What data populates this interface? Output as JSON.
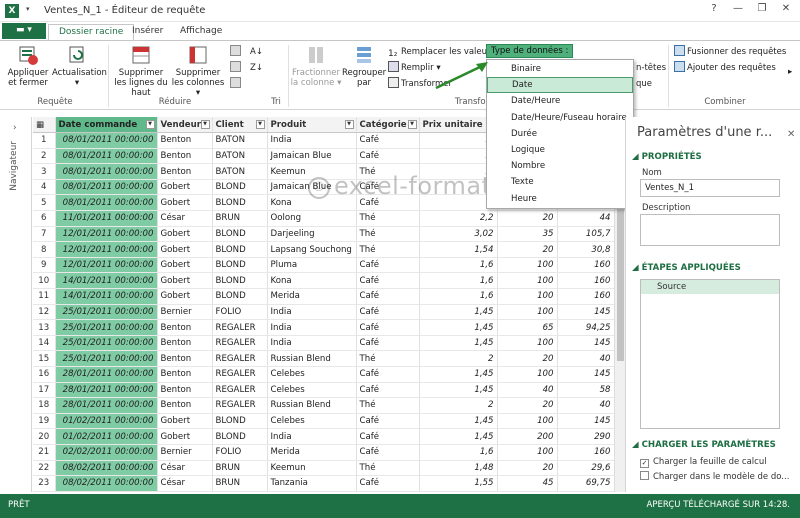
{
  "window": {
    "title": "Ventes_N_1 - Éditeur de requête"
  },
  "ribbon_tabs": [
    "Dossier racine",
    "Insérer",
    "Affichage"
  ],
  "ribbon": {
    "apply_close": "Appliquer et fermer",
    "refresh": "Actualisation",
    "remove_top_rows": "Supprimer les lignes du haut",
    "remove_columns": "Supprimer les colonnes",
    "split_column": "Fractionner la colonne",
    "group_by": "Regrouper par",
    "replace_values": "Remplacer les valeurs",
    "fill": "Remplir",
    "transform": "Transformer",
    "data_type_label": "Type de données :",
    "merge_queries": "Fusionner des requêtes",
    "append_queries": "Ajouter des requêtes",
    "partial_right": "n-têtes",
    "partial_right2": "que",
    "groups": {
      "query": "Requête",
      "reduce": "Réduire",
      "sort": "Tri",
      "transform": "Transfor",
      "combine": "Combiner"
    }
  },
  "data_type_menu": {
    "items": [
      "Binaire",
      "Date",
      "Date/Heure",
      "Date/Heure/Fuseau horaire",
      "Durée",
      "Logique",
      "Nombre",
      "Texte",
      "Heure"
    ],
    "selected": "Date"
  },
  "navigator": {
    "label": "Navigateur"
  },
  "grid": {
    "columns": [
      "Date commande",
      "Vendeur",
      "Client",
      "Produit",
      "Catégorie",
      "Prix unitaire",
      "",
      ""
    ],
    "rows": [
      [
        "1",
        "08/01/2011 00:00:00",
        "Benton",
        "BATON",
        "India",
        "Café",
        "1,",
        "",
        ""
      ],
      [
        "2",
        "08/01/2011 00:00:00",
        "Benton",
        "BATON",
        "Jamaican Blue",
        "Café",
        "1,",
        "",
        ""
      ],
      [
        "3",
        "08/01/2011 00:00:00",
        "Benton",
        "BATON",
        "Keemun",
        "Thé",
        "1,",
        "",
        ""
      ],
      [
        "4",
        "08/01/2011 00:00:00",
        "Gobert",
        "BLOND",
        "Jamaican Blue",
        "Café",
        "",
        "",
        ""
      ],
      [
        "5",
        "08/01/2011 00:00:00",
        "Gobert",
        "BLOND",
        "Kona",
        "Café",
        "",
        "",
        ""
      ],
      [
        "6",
        "11/01/2011 00:00:00",
        "César",
        "BRUN",
        "Oolong",
        "Thé",
        "2,2",
        "20",
        "44"
      ],
      [
        "7",
        "12/01/2011 00:00:00",
        "Gobert",
        "BLOND",
        "Darjeeling",
        "Thé",
        "3,02",
        "35",
        "105,7"
      ],
      [
        "8",
        "12/01/2011 00:00:00",
        "Gobert",
        "BLOND",
        "Lapsang Souchong",
        "Thé",
        "1,54",
        "20",
        "30,8"
      ],
      [
        "9",
        "12/01/2011 00:00:00",
        "Gobert",
        "BLOND",
        "Pluma",
        "Café",
        "1,6",
        "100",
        "160"
      ],
      [
        "10",
        "14/01/2011 00:00:00",
        "Gobert",
        "BLOND",
        "Kona",
        "Café",
        "1,6",
        "100",
        "160"
      ],
      [
        "11",
        "14/01/2011 00:00:00",
        "Gobert",
        "BLOND",
        "Merida",
        "Café",
        "1,6",
        "100",
        "160"
      ],
      [
        "12",
        "25/01/2011 00:00:00",
        "Bernier",
        "FOLIO",
        "India",
        "Café",
        "1,45",
        "100",
        "145"
      ],
      [
        "13",
        "25/01/2011 00:00:00",
        "Benton",
        "REGALER",
        "India",
        "Café",
        "1,45",
        "65",
        "94,25"
      ],
      [
        "14",
        "25/01/2011 00:00:00",
        "Benton",
        "REGALER",
        "India",
        "Café",
        "1,45",
        "100",
        "145"
      ],
      [
        "15",
        "25/01/2011 00:00:00",
        "Benton",
        "REGALER",
        "Russian Blend",
        "Thé",
        "2",
        "20",
        "40"
      ],
      [
        "16",
        "28/01/2011 00:00:00",
        "Benton",
        "REGALER",
        "Celebes",
        "Café",
        "1,45",
        "100",
        "145"
      ],
      [
        "17",
        "28/01/2011 00:00:00",
        "Benton",
        "REGALER",
        "Celebes",
        "Café",
        "1,45",
        "40",
        "58"
      ],
      [
        "18",
        "28/01/2011 00:00:00",
        "Benton",
        "REGALER",
        "Russian Blend",
        "Thé",
        "2",
        "20",
        "40"
      ],
      [
        "19",
        "01/02/2011 00:00:00",
        "Gobert",
        "BLOND",
        "Celebes",
        "Café",
        "1,45",
        "100",
        "145"
      ],
      [
        "20",
        "01/02/2011 00:00:00",
        "Gobert",
        "BLOND",
        "India",
        "Café",
        "1,45",
        "200",
        "290"
      ],
      [
        "21",
        "02/02/2011 00:00:00",
        "Bernier",
        "FOLIO",
        "Merida",
        "Café",
        "1,6",
        "100",
        "160"
      ],
      [
        "22",
        "08/02/2011 00:00:00",
        "César",
        "BRUN",
        "Keemun",
        "Thé",
        "1,48",
        "20",
        "29,6"
      ],
      [
        "23",
        "08/02/2011 00:00:00",
        "César",
        "BRUN",
        "Tanzania",
        "Café",
        "1,55",
        "45",
        "69,75"
      ]
    ]
  },
  "settings_pane": {
    "title": "Paramètres d'une r...",
    "properties_header": "PROPRIÉTÉS",
    "name_label": "Nom",
    "name_value": "Ventes_N_1",
    "description_label": "Description",
    "steps_header": "ÉTAPES APPLIQUÉES",
    "steps": [
      "Source"
    ],
    "load_header": "CHARGER LES PARAMÈTRES",
    "load_sheet": "Charger la feuille de calcul",
    "load_model": "Charger dans le modèle de do..."
  },
  "status": {
    "left": "PRÊT",
    "right": "APERÇU TÉLÉCHARGÉ SUR 14:28."
  },
  "watermark": "excel-formations.fr",
  "colors": {
    "accent": "#1e7145",
    "date_column": "#7fcba4",
    "selected": "#c9ead6"
  }
}
